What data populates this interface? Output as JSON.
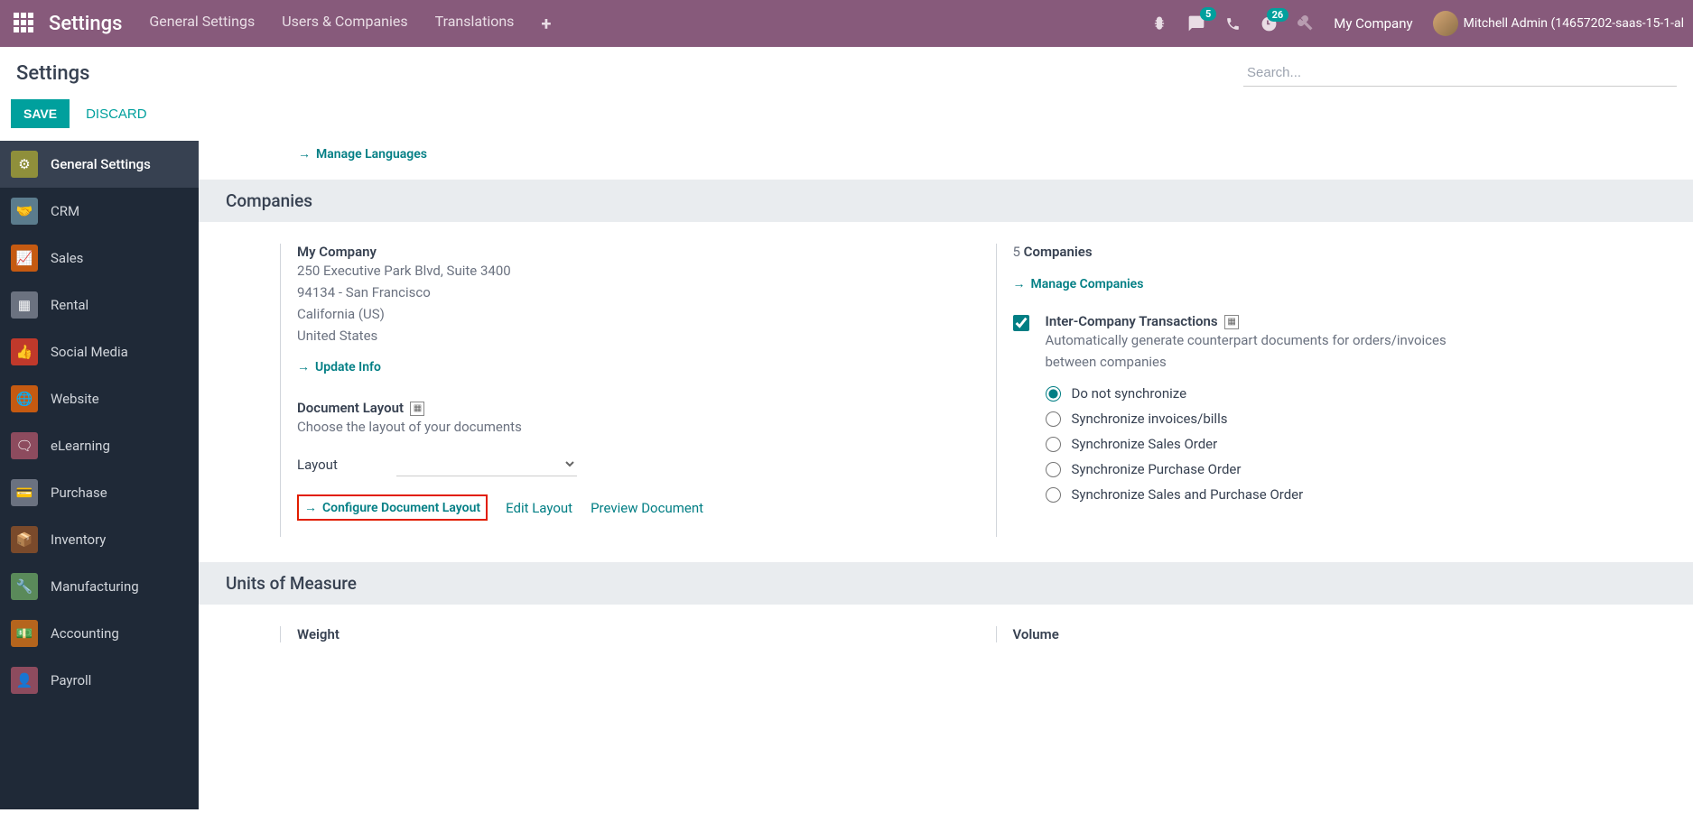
{
  "topbar": {
    "brand": "Settings",
    "nav": [
      "General Settings",
      "Users & Companies",
      "Translations"
    ],
    "messages_badge": "5",
    "activities_badge": "26",
    "company": "My Company",
    "user": "Mitchell Admin (14657202-saas-15-1-al"
  },
  "subheader": {
    "title": "Settings",
    "search_placeholder": "Search..."
  },
  "actions": {
    "save": "SAVE",
    "discard": "DISCARD"
  },
  "sidebar": [
    {
      "label": "General Settings",
      "color": "#8f8f3b",
      "icon": "⚙"
    },
    {
      "label": "CRM",
      "color": "#5b7c8d",
      "icon": "🤝"
    },
    {
      "label": "Sales",
      "color": "#c55a11",
      "icon": "📈"
    },
    {
      "label": "Rental",
      "color": "#6b7280",
      "icon": "▦"
    },
    {
      "label": "Social Media",
      "color": "#c0392b",
      "icon": "👍"
    },
    {
      "label": "Website",
      "color": "#c55a11",
      "icon": "🌐"
    },
    {
      "label": "eLearning",
      "color": "#8d4b5e",
      "icon": "🗨"
    },
    {
      "label": "Purchase",
      "color": "#6b7280",
      "icon": "💳"
    },
    {
      "label": "Inventory",
      "color": "#7a4a2b",
      "icon": "📦"
    },
    {
      "label": "Manufacturing",
      "color": "#5a8a5a",
      "icon": "🔧"
    },
    {
      "label": "Accounting",
      "color": "#b5651d",
      "icon": "💵"
    },
    {
      "label": "Payroll",
      "color": "#8d4b5e",
      "icon": "👤"
    }
  ],
  "prelink": "Manage Languages",
  "companies": {
    "heading": "Companies",
    "name": "My Company",
    "addr1": "250 Executive Park Blvd, Suite 3400",
    "addr2": "94134 - San Francisco",
    "addr3": "California (US)",
    "addr4": "United States",
    "update": "Update Info",
    "doc_title": "Document Layout",
    "doc_sub": "Choose the layout of your documents",
    "layout_label": "Layout",
    "configure": "Configure Document Layout",
    "edit": "Edit Layout",
    "preview": "Preview Document",
    "count_num": "5",
    "count_label": "Companies",
    "manage": "Manage Companies",
    "inter_title": "Inter-Company Transactions",
    "inter_sub": "Automatically generate counterpart documents for orders/invoices between companies",
    "radios": [
      "Do not synchronize",
      "Synchronize invoices/bills",
      "Synchronize Sales Order",
      "Synchronize Purchase Order",
      "Synchronize Sales and Purchase Order"
    ]
  },
  "uom": {
    "heading": "Units of Measure",
    "weight": "Weight",
    "volume": "Volume"
  }
}
